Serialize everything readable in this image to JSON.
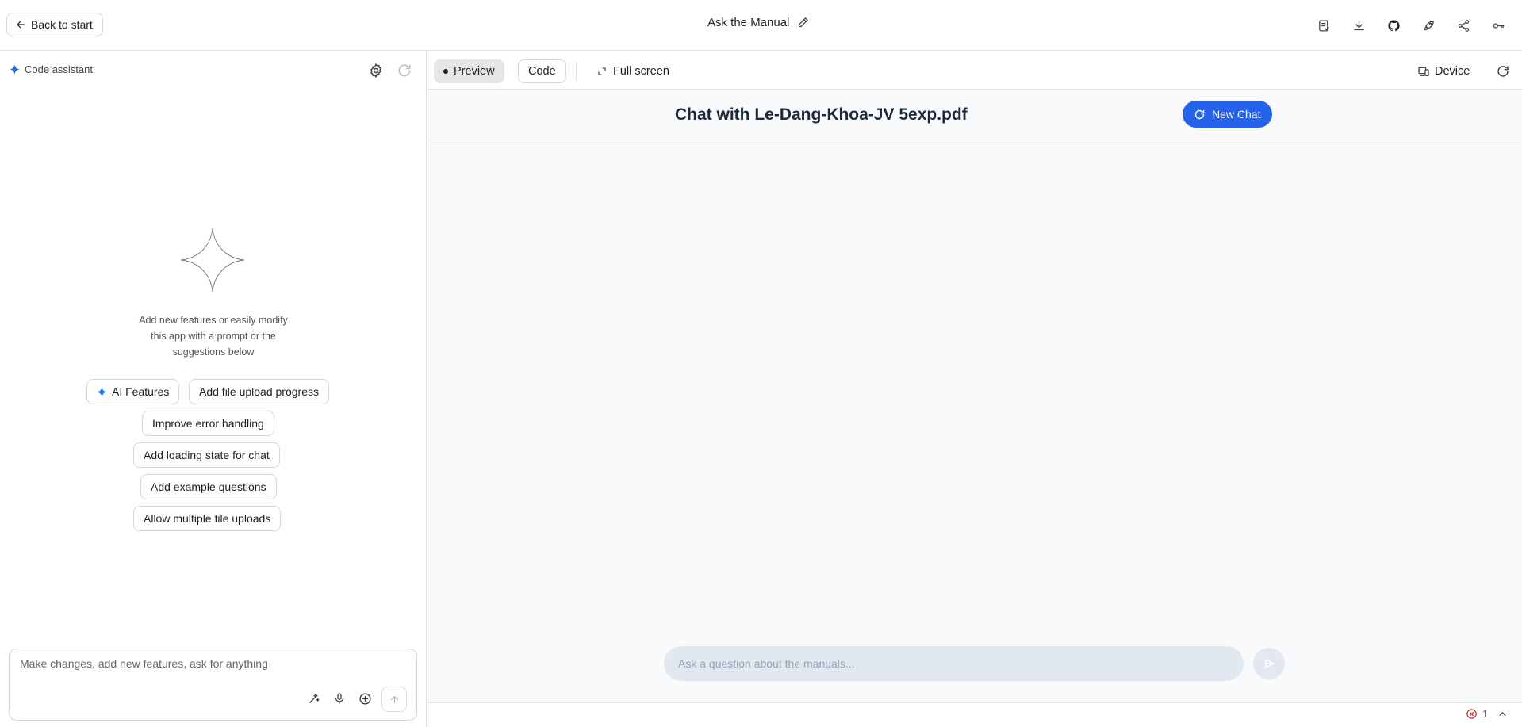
{
  "topbar": {
    "back_label": "Back to start",
    "title": "Ask the Manual",
    "icons": [
      "edit-pencil-icon",
      "changes-icon",
      "download-icon",
      "github-icon",
      "deploy-rocket-icon",
      "share-icon",
      "api-key-icon"
    ]
  },
  "assistant": {
    "header_label": "Code assistant",
    "description": "Add new features or easily modify this app with a prompt or the suggestions below",
    "suggestions": [
      "AI Features",
      "Add file upload progress",
      "Improve error handling",
      "Add loading state for chat",
      "Add example questions",
      "Allow multiple file uploads"
    ],
    "prompt_placeholder": "Make changes, add new features, ask for anything"
  },
  "preview_toolbar": {
    "preview_label": "Preview",
    "code_label": "Code",
    "fullscreen_label": "Full screen",
    "device_label": "Device"
  },
  "app": {
    "title": "Chat with Le-Dang-Khoa-JV 5exp.pdf",
    "new_chat_label": "New Chat",
    "input_placeholder": "Ask a question about the manuals..."
  },
  "status": {
    "error_count": "1"
  },
  "colors": {
    "accent_blue": "#2563eb",
    "sparkle_blue": "#1a73e8",
    "error_red": "#d93025",
    "preview_bg": "#f8fafc"
  }
}
